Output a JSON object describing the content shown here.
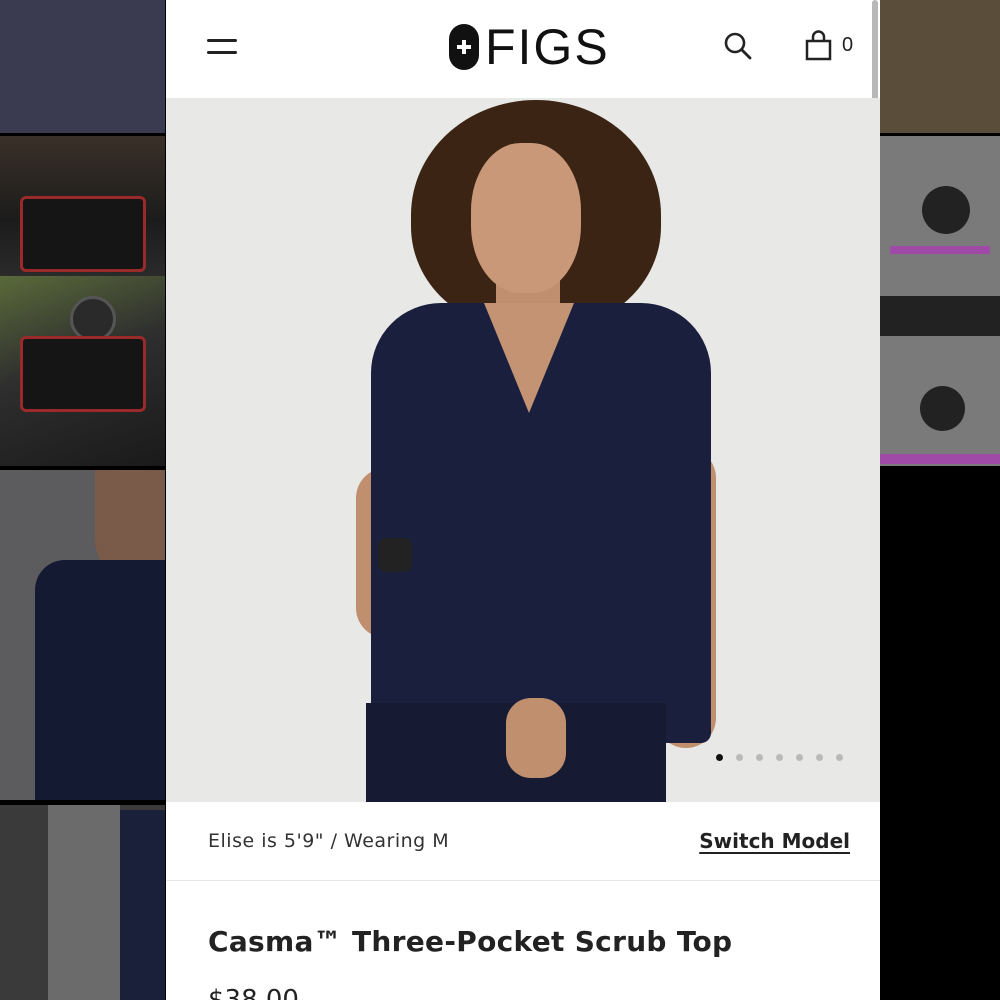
{
  "header": {
    "brand": "FIGS",
    "cart_count": "0"
  },
  "gallery": {
    "slide_count": 7,
    "active_index": 0
  },
  "model_info": {
    "text": "Elise is 5'9\" / Wearing M",
    "switch_label": "Switch Model"
  },
  "product": {
    "title": "Casma™ Three-Pocket Scrub Top",
    "price": "$38.00"
  },
  "colors": {
    "scrub_navy": "#1a1f3d",
    "brand_black": "#111111"
  }
}
